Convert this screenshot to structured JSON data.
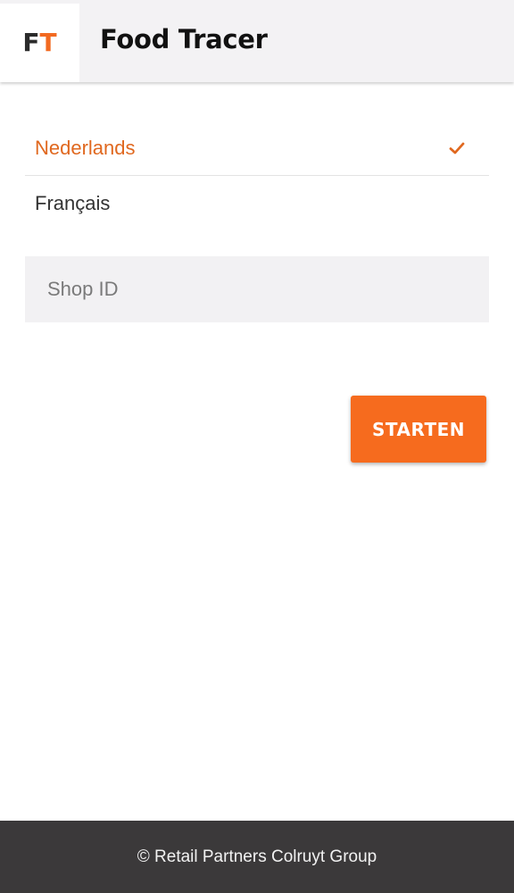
{
  "header": {
    "logo_letter_f": "F",
    "logo_letter_t": "T",
    "title": "Food Tracer"
  },
  "languages": {
    "items": [
      {
        "label": "Nederlands",
        "selected": true
      },
      {
        "label": "Français",
        "selected": false
      }
    ]
  },
  "shop_field": {
    "value": "",
    "placeholder": "Shop ID"
  },
  "start_button": {
    "label": "STARTEN"
  },
  "footer": {
    "text": "© Retail Partners Colruyt Group"
  },
  "icons": {
    "selected_indicator": "check-icon"
  },
  "colors": {
    "accent": "#f26a21",
    "button": "#f66b1e",
    "footer_bg": "#3b393a",
    "header_bg": "#f3f2f4"
  }
}
